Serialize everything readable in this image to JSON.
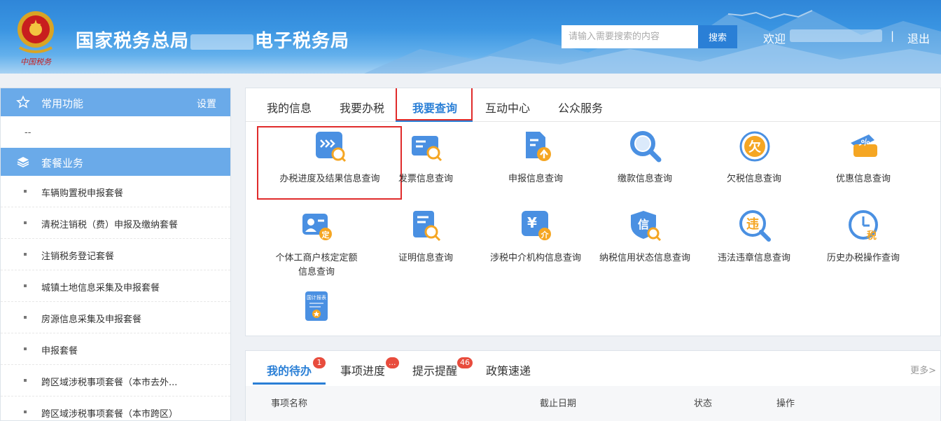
{
  "header": {
    "site_title_prefix": "国家税务总局",
    "site_title_suffix": "电子税务局",
    "search_placeholder": "请输入需要搜索的内容",
    "search_button": "搜索",
    "welcome": "欢迎",
    "separator": "|",
    "logout": "退出"
  },
  "sidebar": {
    "favorites_title": "常用功能",
    "favorites_setting": "设置",
    "favorites_empty": "--",
    "packages_title": "套餐业务",
    "packages": [
      "车辆购置税申报套餐",
      "清税注销税（费）申报及缴纳套餐",
      "注销税务登记套餐",
      "城镇土地信息采集及申报套餐",
      "房源信息采集及申报套餐",
      "申报套餐",
      "跨区域涉税事项套餐（本市去外...",
      "跨区域涉税事项套餐（本市跨区）"
    ]
  },
  "tabs": [
    "我的信息",
    "我要办税",
    "我要查询",
    "互动中心",
    "公众服务"
  ],
  "active_tab": "我要查询",
  "query_items": [
    {
      "label": "办税进度及结果信息查询",
      "icon": "progress-arrows-icon"
    },
    {
      "label": "发票信息查询",
      "icon": "invoice-search-icon"
    },
    {
      "label": "申报信息查询",
      "icon": "declaration-upload-icon"
    },
    {
      "label": "缴款信息查询",
      "icon": "magnifier-icon"
    },
    {
      "label": "欠税信息查询",
      "icon": "tax-arrears-icon"
    },
    {
      "label": "优惠信息查询",
      "icon": "discount-percent-icon"
    },
    {
      "label": "个体工商户核定定额信息查询",
      "icon": "individual-quota-icon"
    },
    {
      "label": "证明信息查询",
      "icon": "certificate-search-icon"
    },
    {
      "label": "涉税中介机构信息查询",
      "icon": "agency-yen-icon"
    },
    {
      "label": "纳税信用状态信息查询",
      "icon": "credit-shield-icon"
    },
    {
      "label": "违法违章信息查询",
      "icon": "violation-search-icon"
    },
    {
      "label": "历史办税操作查询",
      "icon": "history-clock-icon"
    },
    {
      "label": "",
      "icon": "statistics-report-icon",
      "icon_text": "国计报表"
    }
  ],
  "todo": {
    "tabs": [
      {
        "label": "我的待办",
        "badge": "1"
      },
      {
        "label": "事项进度",
        "badge": "..."
      },
      {
        "label": "提示提醒",
        "badge": "46"
      },
      {
        "label": "政策速递",
        "badge": ""
      }
    ],
    "more": "更多>",
    "columns": [
      "事项名称",
      "截止日期",
      "状态",
      "操作"
    ]
  },
  "colors": {
    "accent": "#2a7fd6",
    "sidebar_header": "#6aaae9",
    "highlight_box": "#e02b2b",
    "badge": "#e84c3d"
  }
}
